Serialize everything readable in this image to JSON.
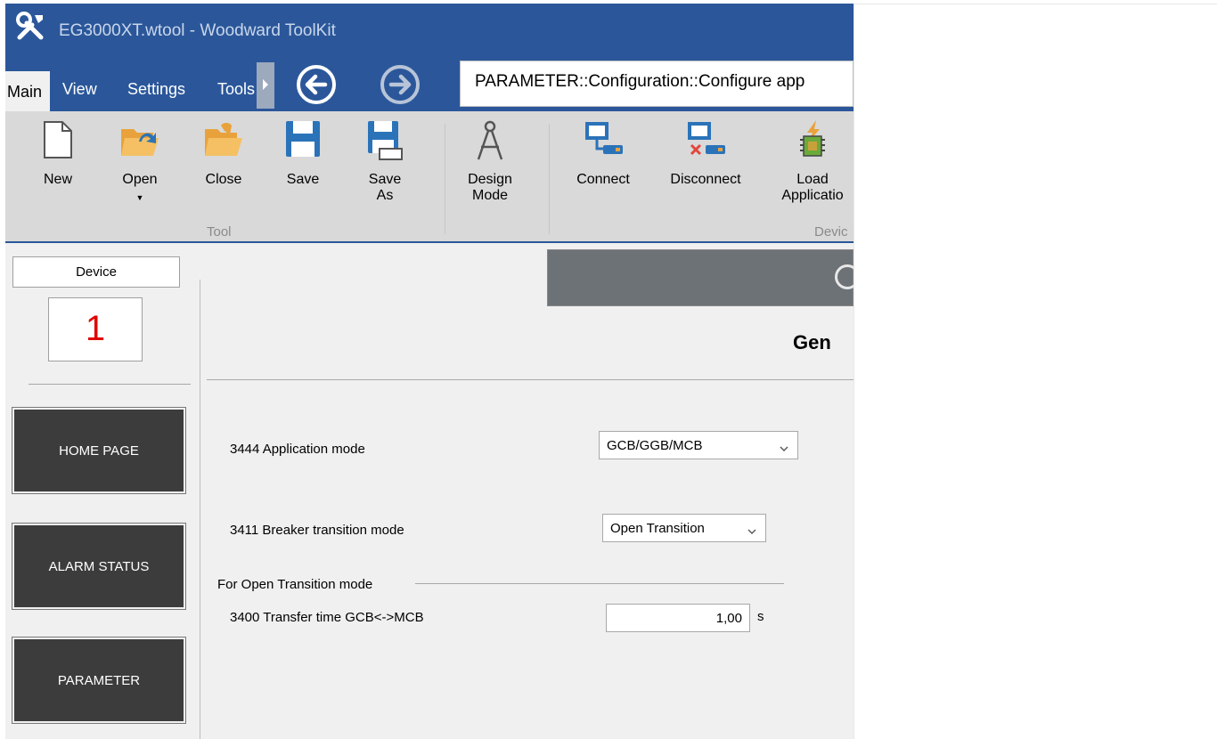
{
  "window": {
    "title": "EG3000XT.wtool - Woodward ToolKit"
  },
  "menu": {
    "tabs": [
      "Main",
      "View",
      "Settings",
      "Tools"
    ]
  },
  "breadcrumb": "PARAMETER::Configuration::Configure app",
  "ribbon": {
    "tool_group": {
      "label": "Tool",
      "buttons": {
        "new": "New",
        "open": "Open",
        "close": "Close",
        "save": "Save",
        "save_as": "Save\nAs"
      }
    },
    "design_mode": "Design\nMode",
    "device_group": {
      "label": "Devic",
      "buttons": {
        "connect": "Connect",
        "disconnect": "Disconnect",
        "load_application": "Load\nApplicatio"
      }
    }
  },
  "left_panel": {
    "device_label": "Device",
    "device_number": "1",
    "tiles": {
      "home": "HOME PAGE",
      "alarm": "ALARM STATUS",
      "parameter": "PARAMETER"
    }
  },
  "page": {
    "title": "Gen",
    "params": {
      "application_mode": {
        "label": "3444 Application mode",
        "value": "GCB/GGB/MCB"
      },
      "breaker_transition_mode": {
        "label": "3411 Breaker transition mode",
        "value": "Open Transition"
      },
      "open_transition_group": "For Open Transition mode",
      "transfer_time": {
        "label": "3400 Transfer time GCB<->MCB",
        "value": "1,00",
        "unit": "s"
      }
    }
  },
  "colors": {
    "accent": "#2b579a",
    "ribbon_bg": "#d9d9d9",
    "tile_bg": "#3c3c3c",
    "header_band": "#6d7277",
    "device_number": "#e00000"
  },
  "icons": [
    "tools-icon",
    "back-arrow-icon",
    "forward-arrow-icon",
    "new-document-icon",
    "open-folder-icon",
    "close-folder-icon",
    "save-disk-icon",
    "save-as-disk-icon",
    "compass-icon",
    "connect-monitor-icon",
    "disconnect-monitor-icon",
    "load-application-chip-icon",
    "chevron-down-icon"
  ]
}
